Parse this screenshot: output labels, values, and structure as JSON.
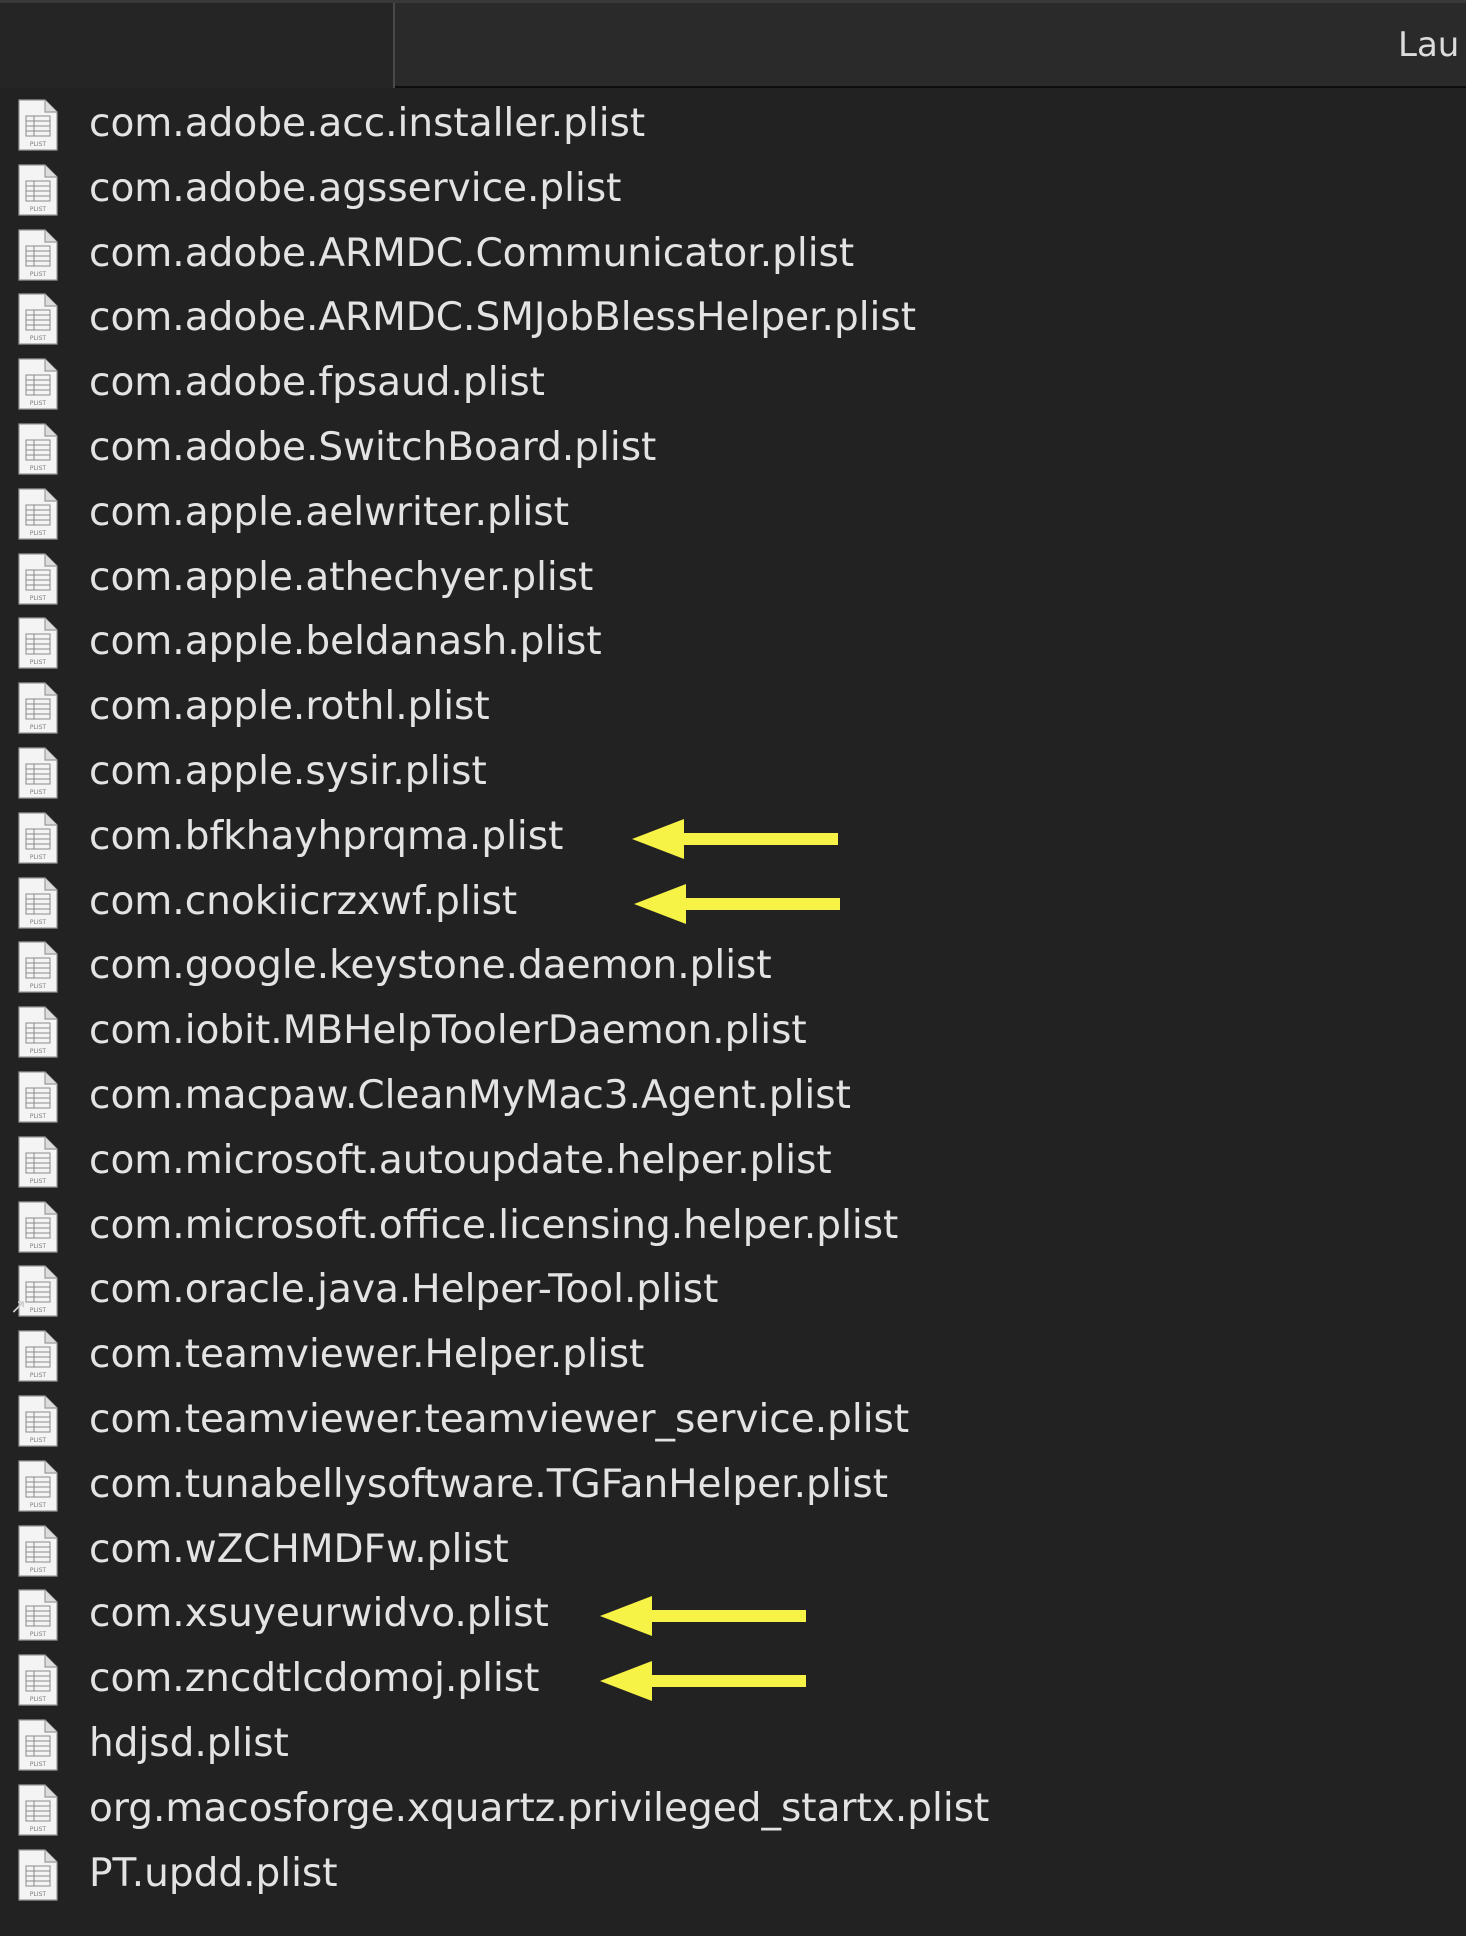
{
  "window": {
    "header_title": "Lau"
  },
  "icons": {
    "file": "plist-document-icon",
    "alias": "alias-arrow-icon",
    "marker": "yellow-arrow-annotation"
  },
  "colors": {
    "background": "#232222",
    "header": "#2b2a2a",
    "text": "#e3e3e3",
    "marker": "#f7f246"
  },
  "files": [
    {
      "name": "com.adobe.acc.installer.plist"
    },
    {
      "name": "com.adobe.agsservice.plist"
    },
    {
      "name": "com.adobe.ARMDC.Communicator.plist"
    },
    {
      "name": "com.adobe.ARMDC.SMJobBlessHelper.plist"
    },
    {
      "name": "com.adobe.fpsaud.plist"
    },
    {
      "name": "com.adobe.SwitchBoard.plist"
    },
    {
      "name": "com.apple.aelwriter.plist"
    },
    {
      "name": "com.apple.athechyer.plist"
    },
    {
      "name": "com.apple.beldanash.plist"
    },
    {
      "name": "com.apple.rothl.plist"
    },
    {
      "name": "com.apple.sysir.plist"
    },
    {
      "name": "com.bfkhayhprqma.plist",
      "flagged": true
    },
    {
      "name": "com.cnokiicrzxwf.plist",
      "flagged": true
    },
    {
      "name": "com.google.keystone.daemon.plist"
    },
    {
      "name": "com.iobit.MBHelpToolerDaemon.plist"
    },
    {
      "name": "com.macpaw.CleanMyMac3.Agent.plist"
    },
    {
      "name": "com.microsoft.autoupdate.helper.plist"
    },
    {
      "name": "com.microsoft.office.licensing.helper.plist"
    },
    {
      "name": "com.oracle.java.Helper-Tool.plist",
      "alias": true
    },
    {
      "name": "com.teamviewer.Helper.plist"
    },
    {
      "name": "com.teamviewer.teamviewer_service.plist"
    },
    {
      "name": "com.tunabellysoftware.TGFanHelper.plist"
    },
    {
      "name": "com.wZCHMDFw.plist"
    },
    {
      "name": "com.xsuyeurwidvo.plist",
      "flagged": true
    },
    {
      "name": "com.zncdtlcdomoj.plist",
      "flagged": true
    },
    {
      "name": "hdjsd.plist"
    },
    {
      "name": "org.macosforge.xquartz.privileged_startx.plist"
    },
    {
      "name": "PT.updd.plist"
    }
  ]
}
